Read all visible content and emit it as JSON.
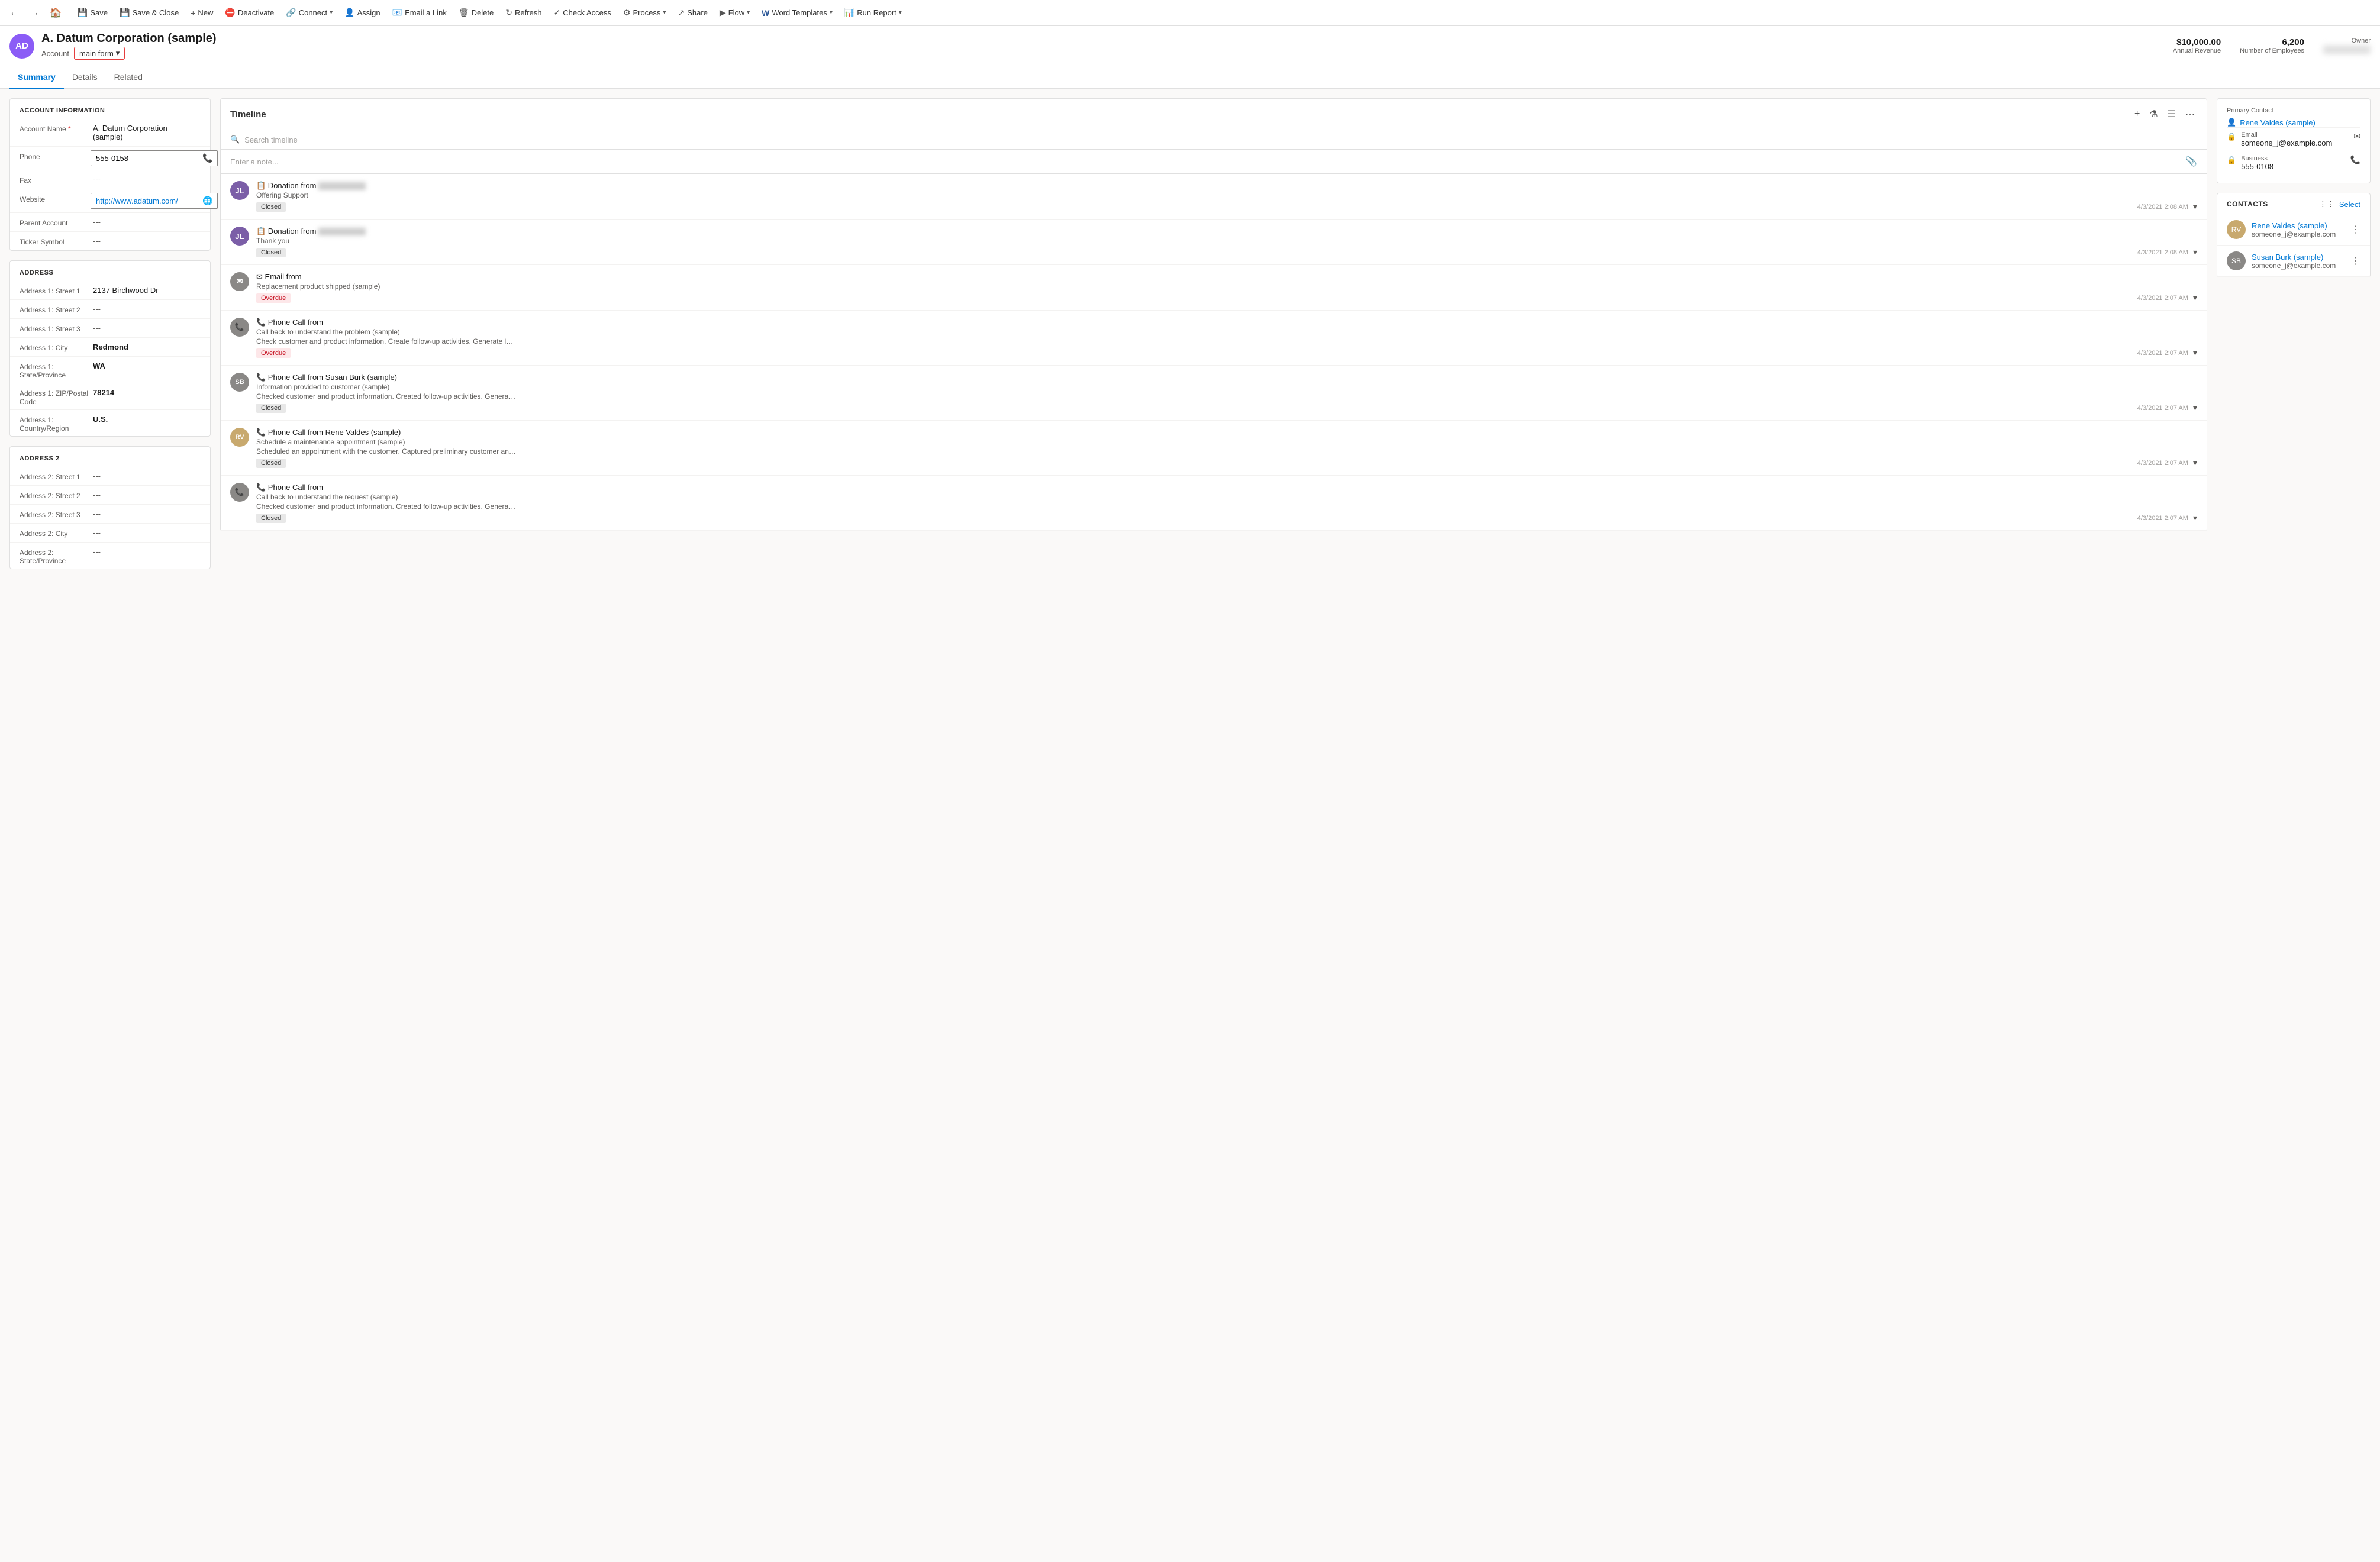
{
  "toolbar": {
    "save_label": "Save",
    "save_close_label": "Save & Close",
    "new_label": "New",
    "deactivate_label": "Deactivate",
    "connect_label": "Connect",
    "assign_label": "Assign",
    "email_link_label": "Email a Link",
    "delete_label": "Delete",
    "refresh_label": "Refresh",
    "check_access_label": "Check Access",
    "process_label": "Process",
    "share_label": "Share",
    "flow_label": "Flow",
    "word_templates_label": "Word Templates",
    "run_report_label": "Run Report"
  },
  "header": {
    "avatar_initials": "AD",
    "name": "A. Datum Corporation (sample)",
    "type": "Account",
    "form_label": "main form",
    "annual_revenue_value": "$10,000.00",
    "annual_revenue_label": "Annual Revenue",
    "employees_value": "6,200",
    "employees_label": "Number of Employees",
    "owner_label": "Owner",
    "owner_value": "—"
  },
  "tabs": {
    "summary": "Summary",
    "details": "Details",
    "related": "Related"
  },
  "account_info": {
    "section_title": "ACCOUNT INFORMATION",
    "account_name_label": "Account Name",
    "account_name_value": "A. Datum Corporation (sample)",
    "phone_label": "Phone",
    "phone_value": "555-0158",
    "fax_label": "Fax",
    "fax_value": "---",
    "website_label": "Website",
    "website_value": "http://www.adatum.com/",
    "parent_label": "Parent Account",
    "parent_value": "---",
    "ticker_label": "Ticker Symbol",
    "ticker_value": "---"
  },
  "address1": {
    "section_title": "ADDRESS",
    "street1_label": "Address 1: Street 1",
    "street1_value": "2137 Birchwood Dr",
    "street2_label": "Address 1: Street 2",
    "street2_value": "---",
    "street3_label": "Address 1: Street 3",
    "street3_value": "---",
    "city_label": "Address 1: City",
    "city_value": "Redmond",
    "state_label": "Address 1: State/Province",
    "state_value": "WA",
    "zip_label": "Address 1: ZIP/Postal Code",
    "zip_value": "78214",
    "country_label": "Address 1: Country/Region",
    "country_value": "U.S."
  },
  "address2": {
    "section_title": "ADDRESS 2",
    "street1_label": "Address 2: Street 1",
    "street1_value": "---",
    "street2_label": "Address 2: Street 2",
    "street2_value": "---",
    "street3_label": "Address 2: Street 3",
    "street3_value": "---",
    "city_label": "Address 2: City",
    "city_value": "---",
    "state_label": "Address 2: State/Province",
    "state_value": "---"
  },
  "timeline": {
    "title": "Timeline",
    "search_placeholder": "Search timeline",
    "note_placeholder": "Enter a note...",
    "items": [
      {
        "id": 1,
        "type": "case",
        "avatar_initials": "JL",
        "avatar_color": "#7b5ea7",
        "title_prefix": "Donation from",
        "title_blurred": true,
        "subtitle": "Offering Support",
        "badge": "Closed",
        "badge_type": "closed",
        "time": "4/3/2021 2:08 AM",
        "has_description": false
      },
      {
        "id": 2,
        "type": "case",
        "avatar_initials": "JL",
        "avatar_color": "#7b5ea7",
        "title_prefix": "Donation from",
        "title_blurred": true,
        "subtitle": "Thank you",
        "badge": "Closed",
        "badge_type": "closed",
        "time": "4/3/2021 2:08 AM",
        "has_description": false
      },
      {
        "id": 3,
        "type": "email",
        "avatar_initials": "",
        "avatar_color": "#8a8886",
        "title": "Email from",
        "subtitle": "Replacement product shipped (sample)",
        "badge": "Overdue",
        "badge_type": "overdue",
        "time": "4/3/2021 2:07 AM",
        "has_description": false
      },
      {
        "id": 4,
        "type": "phone",
        "avatar_initials": "",
        "avatar_color": "#8a8886",
        "title": "Phone Call from",
        "subtitle": "Call back to understand the problem (sample)",
        "description": "Check customer and product information. Create follow-up activities. Generate letter or email using the relevant te...",
        "badge": "Overdue",
        "badge_type": "overdue",
        "time": "4/3/2021 2:07 AM",
        "has_description": true
      },
      {
        "id": 5,
        "type": "phone",
        "avatar_initials": "SB",
        "avatar_color": "#8a8886",
        "title": "Phone Call from Susan Burk (sample)",
        "subtitle": "Information provided to customer (sample)",
        "description": "Checked customer and product information. Created follow-up activities. Generated email using the relevant templ...",
        "badge": "Closed",
        "badge_type": "closed",
        "time": "4/3/2021 2:07 AM",
        "has_description": true
      },
      {
        "id": 6,
        "type": "phone",
        "avatar_initials": "RV",
        "avatar_color": "#c8a96e",
        "title": "Phone Call from Rene Valdes (sample)",
        "subtitle": "Schedule a maintenance appointment (sample)",
        "description": "Scheduled an appointment with the customer. Captured preliminary customer and product information. Generated ...",
        "badge": "Closed",
        "badge_type": "closed",
        "time": "4/3/2021 2:07 AM",
        "has_description": true
      },
      {
        "id": 7,
        "type": "phone",
        "avatar_initials": "",
        "avatar_color": "#8a8886",
        "title": "Phone Call from",
        "subtitle": "Call back to understand the request (sample)",
        "description": "Checked customer and product information. Created follow-up activities. Generated email using the relevant templ...",
        "badge": "Closed",
        "badge_type": "closed",
        "time": "4/3/2021 2:07 AM",
        "has_description": true
      }
    ]
  },
  "primary_contact": {
    "label": "Primary Contact",
    "name": "Rene Valdes (sample)",
    "email_label": "Email",
    "email_value": "someone_j@example.com",
    "business_label": "Business",
    "business_value": "555-0108"
  },
  "contacts": {
    "title": "CONTACTS",
    "select_label": "Select",
    "items": [
      {
        "name": "Rene Valdes (sample)",
        "email": "someone_j@example.com",
        "avatar_initials": "RV",
        "avatar_color": "#c8a96e"
      },
      {
        "name": "Susan Burk (sample)",
        "email": "someone_j@example.com",
        "avatar_initials": "SB",
        "avatar_color": "#8a8886"
      }
    ]
  }
}
